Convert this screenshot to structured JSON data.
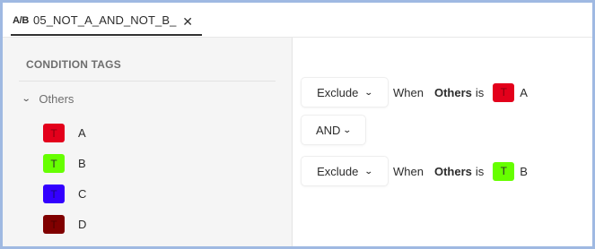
{
  "tab": {
    "icon_text": "A/B",
    "label": "05_NOT_A_AND_NOT_B_",
    "close_glyph": "✕"
  },
  "left_panel": {
    "title": "CONDITION TAGS",
    "group": {
      "label": "Others",
      "expanded": true,
      "tags": [
        {
          "label": "A",
          "swatch_text": "T",
          "color": "#e3001b",
          "text_color": "#8a0010"
        },
        {
          "label": "B",
          "swatch_text": "T",
          "color": "#66ff00",
          "text_color": "#2c2c2c"
        },
        {
          "label": "C",
          "swatch_text": "T",
          "color": "#3300ff",
          "text_color": "#1a0a7a"
        },
        {
          "label": "D",
          "swatch_text": "T",
          "color": "#800000",
          "text_color": "#4d0000"
        }
      ]
    }
  },
  "rules": [
    {
      "mode": "Exclude",
      "when": "When",
      "group": "Others",
      "is": "is",
      "tag_label": "A",
      "tag_text": "T",
      "tag_color": "#e3001b",
      "tag_text_color": "#8a0010"
    },
    {
      "mode": "Exclude",
      "when": "When",
      "group": "Others",
      "is": "is",
      "tag_label": "B",
      "tag_text": "T",
      "tag_color": "#66ff00",
      "tag_text_color": "#2c2c2c"
    }
  ],
  "operator": "AND"
}
